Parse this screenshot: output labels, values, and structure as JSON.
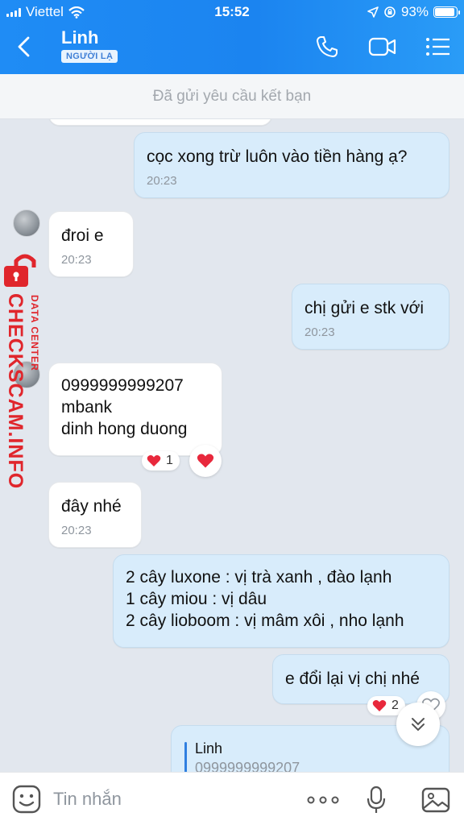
{
  "status": {
    "carrier": "Viettel",
    "time": "15:52",
    "battery": "93%"
  },
  "header": {
    "contact_name": "Linh",
    "badge": "NGƯỜI LẠ"
  },
  "friend_request": "Đã gửi yêu cầu kết bạn",
  "messages": [
    {
      "side": "me",
      "text": "cọc xong trừ luôn vào tiền hàng ạ?",
      "time": "20:23"
    },
    {
      "side": "them",
      "text": "đroi e",
      "time": "20:23"
    },
    {
      "side": "me",
      "text": "chị gửi e stk với",
      "time": "20:23"
    },
    {
      "side": "them",
      "text": "0999999999207\nmbank\ndinh hong duong",
      "reaction_count": "1"
    },
    {
      "side": "them",
      "text": "đây nhé",
      "time": "20:23"
    },
    {
      "side": "me",
      "text": "2 cây luxone : vị trà xanh , đào lạnh\n1 cây miou : vị dâu\n2 cây lioboom : vị mâm xôi , nho lạnh"
    },
    {
      "side": "me",
      "text": "e đổi lại vị chị nhé",
      "reaction_count": "2"
    },
    {
      "side": "me",
      "quote_name": "Linh",
      "quote_text": "0999999999207"
    }
  ],
  "watermark": {
    "line1": "DATA CENTER",
    "line2": "CHECKSCAM.INFO"
  },
  "input": {
    "placeholder": "Tin nhắn"
  },
  "colors": {
    "header_blue": "#1b84f0",
    "my_bubble": "#d8ecfb",
    "their_bubble": "#ffffff",
    "heart": "#e8283c"
  }
}
